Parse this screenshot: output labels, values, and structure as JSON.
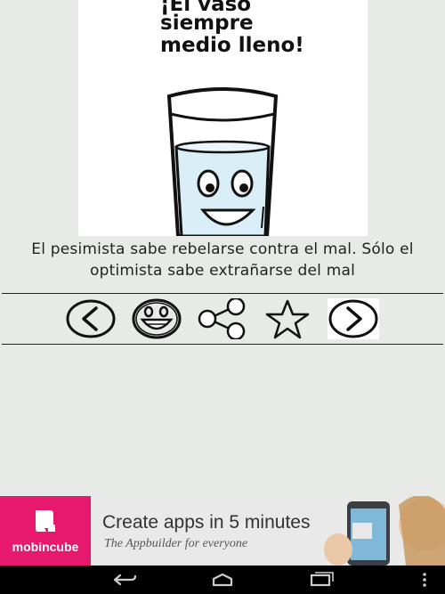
{
  "image": {
    "caption_lines": [
      "¡El vaso",
      "siempre",
      "medio lleno!"
    ]
  },
  "quote": {
    "line1": "El pesimista sabe rebelarse contra el mal. Sólo el",
    "line2": "optimista sabe extrañarse del mal"
  },
  "toolbar": {
    "prev": "chevron-left-icon",
    "face": "smiley-icon",
    "share": "share-icon",
    "favorite": "star-icon",
    "next": "chevron-right-icon"
  },
  "ad": {
    "brand": "mobincube",
    "title": "Create apps in 5 minutes",
    "subtitle": "The Appbuilder for everyone",
    "brand_color": "#e6196d"
  },
  "navbar": {
    "back": "back-icon",
    "home": "home-icon",
    "recents": "recents-icon",
    "menu": "menu-icon"
  }
}
